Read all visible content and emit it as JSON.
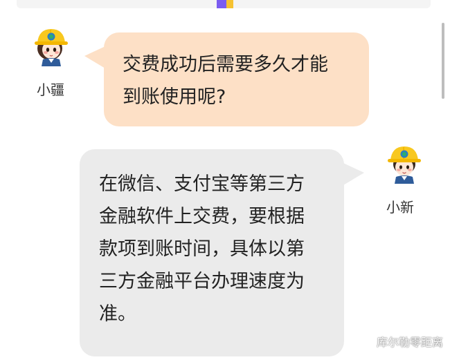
{
  "colors": {
    "question_bubble": "#fde0c6",
    "answer_bubble": "#ebebeb",
    "accent_purple": "#7b5cf0",
    "accent_yellow": "#f6c231",
    "helmet_yellow": "#f8c81f"
  },
  "chat": {
    "messages": [
      {
        "speaker": "小疆",
        "text": "交费成功后需要多久才能\n到账使用呢?",
        "avatar_icon": "hardhat-avatar-icon"
      },
      {
        "speaker": "小新",
        "text": "在微信、支付宝等第三方\n金融软件上交费，要根据\n款项到账时间，具体以第\n三方金融平台办理速度为\n准。",
        "avatar_icon": "hardhat-avatar-icon"
      }
    ]
  },
  "watermark": {
    "text": "库尔勒零距离",
    "icon": "wechat-icon"
  }
}
